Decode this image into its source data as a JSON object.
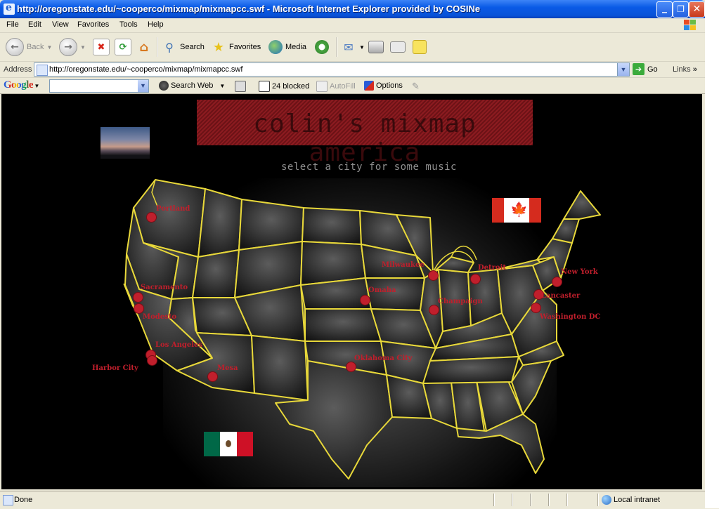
{
  "window": {
    "title": "http://oregonstate.edu/~cooperco/mixmap/mixmapcc.swf - Microsoft Internet Explorer provided by COSINe",
    "minimize": "_",
    "restore": "❐",
    "close": "✕"
  },
  "menu": [
    "File",
    "Edit",
    "View",
    "Favorites",
    "Tools",
    "Help"
  ],
  "toolbar": {
    "back": "Back",
    "search": "Search",
    "favorites": "Favorites",
    "media": "Media"
  },
  "address": {
    "label": "Address",
    "url": "http://oregonstate.edu/~cooperco/mixmap/mixmapcc.swf",
    "go": "Go",
    "links": "Links"
  },
  "google": {
    "logo": "Google",
    "search_web": "Search Web",
    "blocked": "24 blocked",
    "autofill": "AutoFill",
    "options": "Options"
  },
  "page": {
    "banner": "colin's mixmap america",
    "subtitle": "select a city for some music",
    "cities": [
      {
        "label": "Portland"
      },
      {
        "label": "Sacramento"
      },
      {
        "label": "Modesto"
      },
      {
        "label": "Los Angeles"
      },
      {
        "label": "Harbor City"
      },
      {
        "label": "Mesa"
      },
      {
        "label": "Omaha"
      },
      {
        "label": "Oklahoma City"
      },
      {
        "label": "Milwaukee"
      },
      {
        "label": "Champaign"
      },
      {
        "label": "Detroit"
      },
      {
        "label": "New York"
      },
      {
        "label": "Lancaster"
      },
      {
        "label": "Washington DC"
      }
    ]
  },
  "status": {
    "text": "Done",
    "zone": "Local intranet"
  },
  "colors": {
    "titlebar": "#0a5ae6",
    "map_outline": "#e8d83a",
    "city": "#c01f2c",
    "banner": "#8c1b20"
  }
}
